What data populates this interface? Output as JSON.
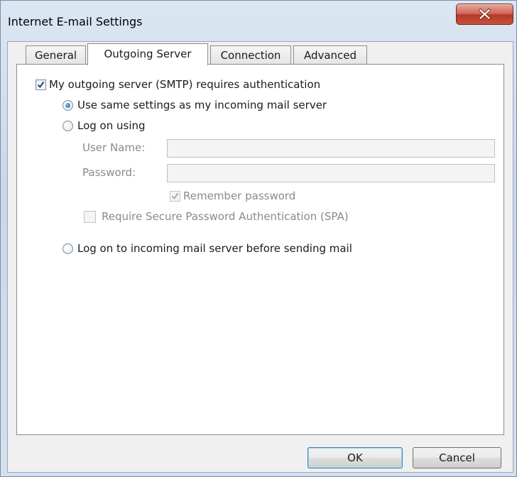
{
  "window": {
    "title": "Internet E-mail Settings"
  },
  "tabs": [
    {
      "label": "General",
      "active": false
    },
    {
      "label": "Outgoing Server",
      "active": true
    },
    {
      "label": "Connection",
      "active": false
    },
    {
      "label": "Advanced",
      "active": false
    }
  ],
  "outgoing": {
    "requires_auth": {
      "label": "My outgoing server (SMTP) requires authentication",
      "checked": true
    },
    "same_settings": {
      "label": "Use same settings as my incoming mail server",
      "selected": true
    },
    "log_on_using": {
      "label": "Log on using",
      "selected": false
    },
    "user_name": {
      "label": "User Name:",
      "value": ""
    },
    "password": {
      "label": "Password:",
      "value": ""
    },
    "remember_password": {
      "label": "Remember password",
      "checked": true,
      "disabled": true
    },
    "spa": {
      "label": "Require Secure Password Authentication (SPA)",
      "checked": false,
      "disabled": true
    },
    "log_on_before_sending": {
      "label": "Log on to incoming mail server before sending mail",
      "selected": false
    }
  },
  "buttons": {
    "ok": "OK",
    "cancel": "Cancel"
  },
  "colors": {
    "close_button": "#c9523c",
    "radio_selected": "#1a5fa8",
    "default_button_border": "#3c7fb1"
  },
  "icons": {
    "close": "close-icon",
    "check": "check-icon"
  }
}
